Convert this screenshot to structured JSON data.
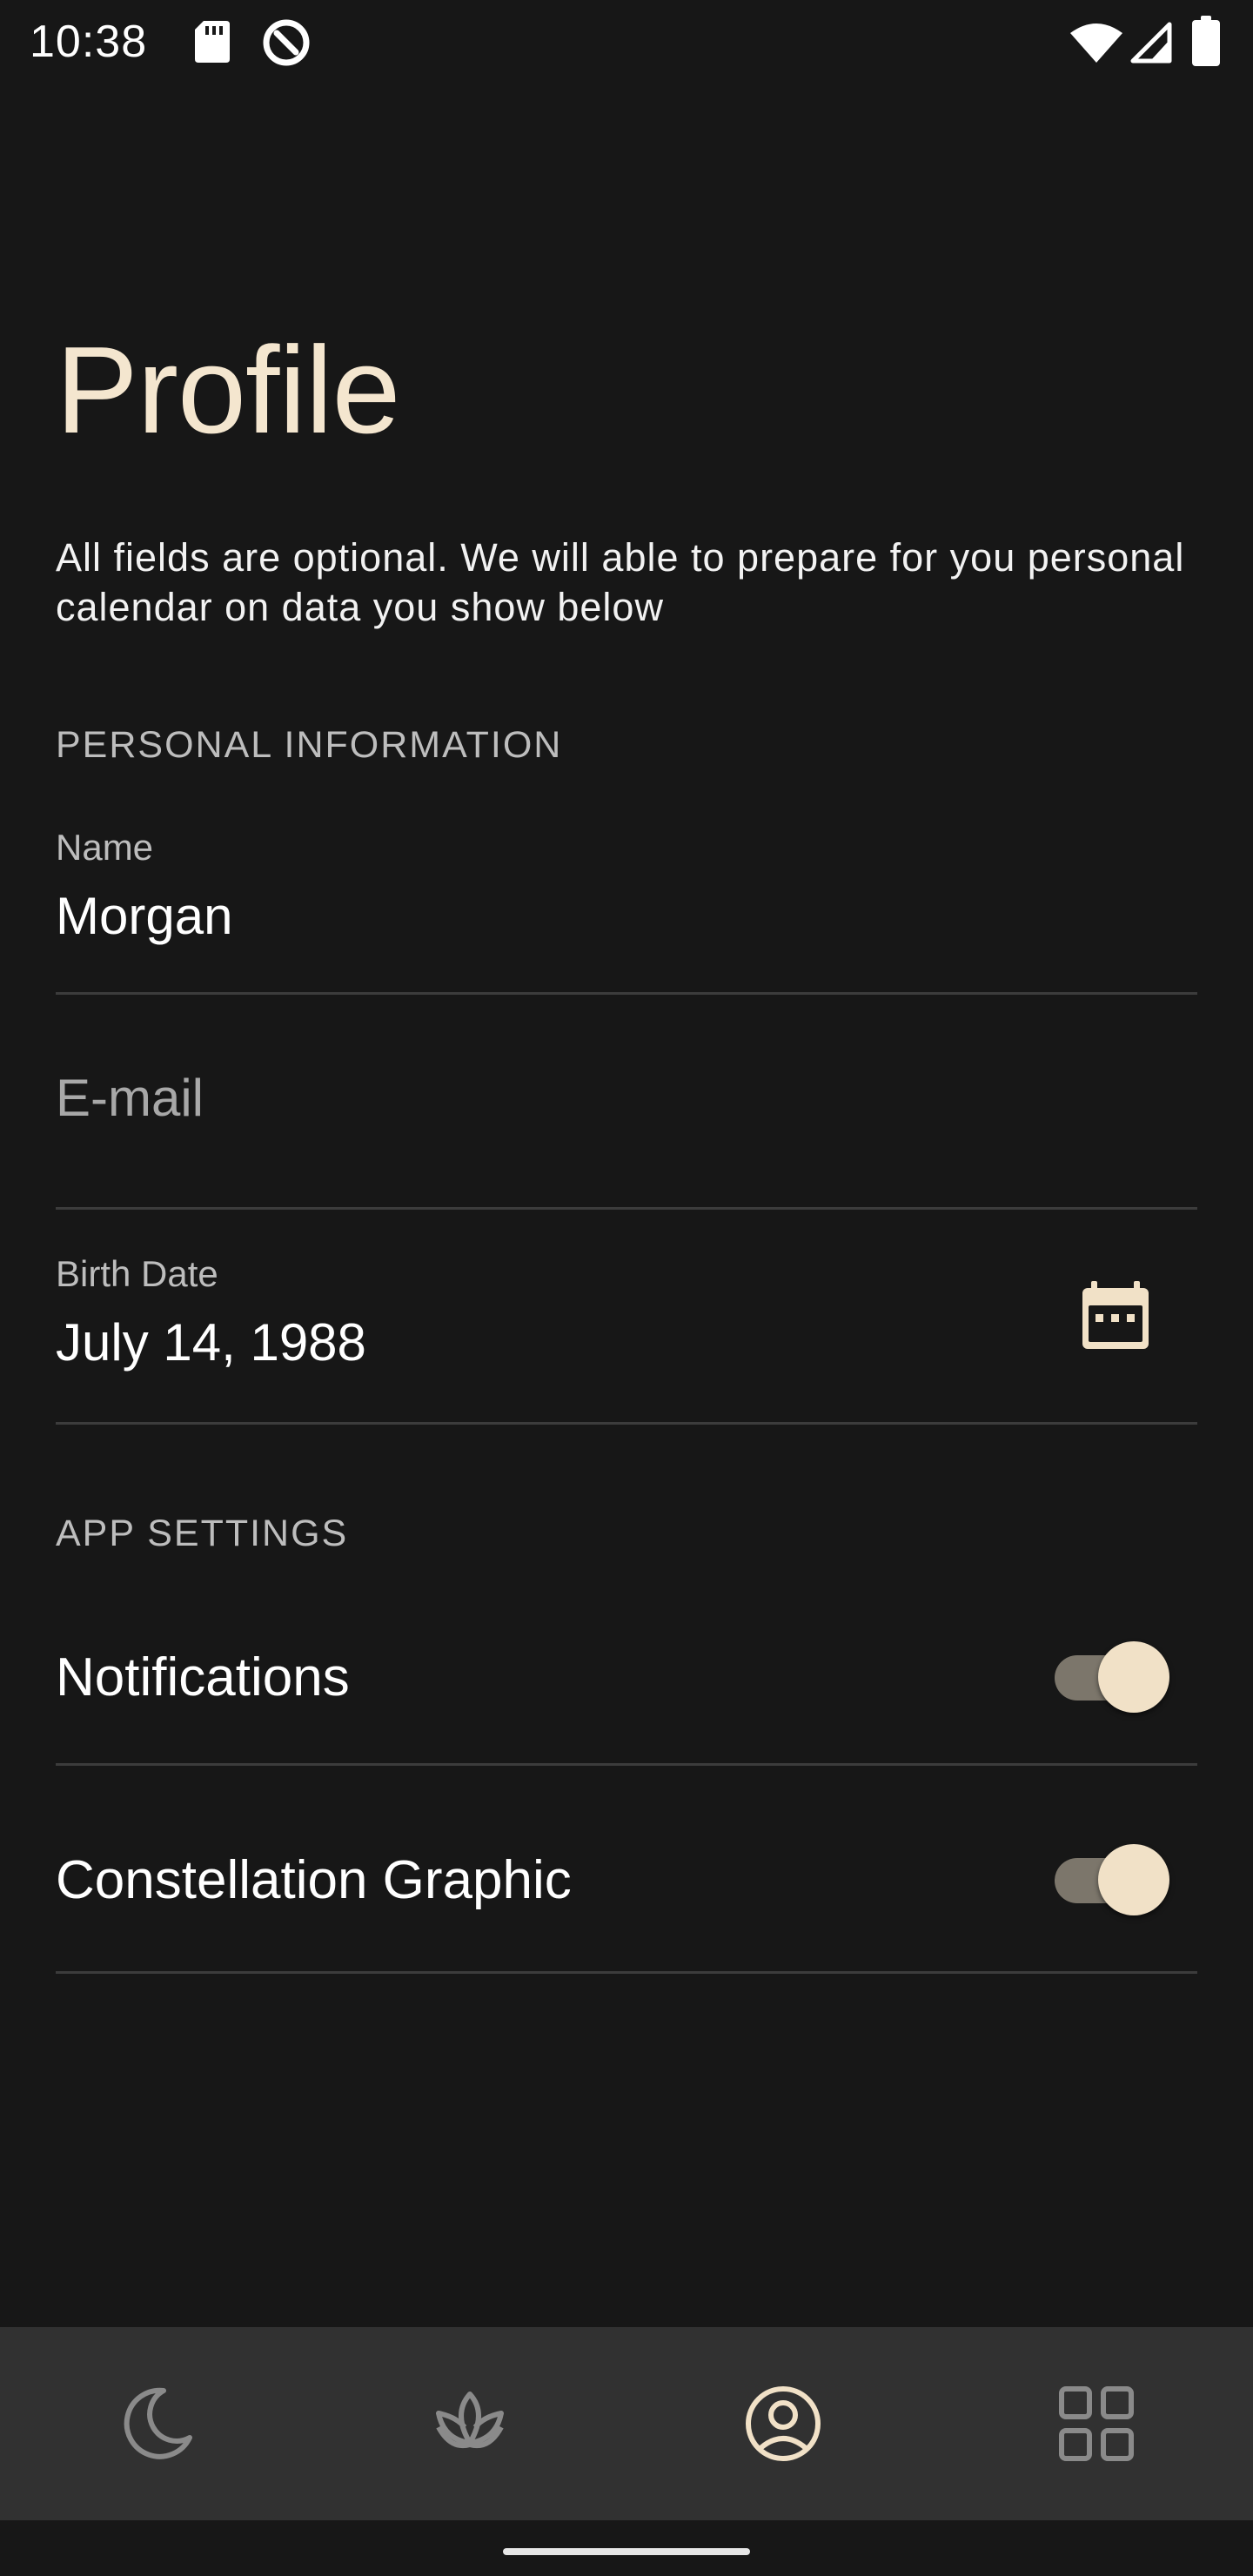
{
  "status_bar": {
    "time": "10:38",
    "icons": [
      "sd-card-icon",
      "data-saver-icon",
      "wifi-icon",
      "signal-icon",
      "battery-icon"
    ]
  },
  "header": {
    "title": "Profile",
    "subtitle": "All fields are optional. We will able to prepare for you personal calendar on data you show below"
  },
  "personal_section": {
    "header": "PERSONAL INFORMATION",
    "name": {
      "label": "Name",
      "value": "Morgan"
    },
    "email": {
      "placeholder": "E-mail",
      "value": ""
    },
    "birth_date": {
      "label": "Birth Date",
      "value": "July 14, 1988",
      "icon": "calendar-icon"
    }
  },
  "app_settings": {
    "header": "APP SETTINGS",
    "items": [
      {
        "label": "Notifications",
        "enabled": true
      },
      {
        "label": "Constellation Graphic",
        "enabled": true
      }
    ]
  },
  "bottom_nav": {
    "items": [
      {
        "icon": "moon-icon",
        "selected": false
      },
      {
        "icon": "lotus-icon",
        "selected": false
      },
      {
        "icon": "profile-icon",
        "selected": true
      },
      {
        "icon": "grid-icon",
        "selected": false
      }
    ]
  },
  "colors": {
    "background": "#171717",
    "accent": "#f4e6cf",
    "nav_background": "#313131",
    "divider": "#3c3c3c"
  }
}
